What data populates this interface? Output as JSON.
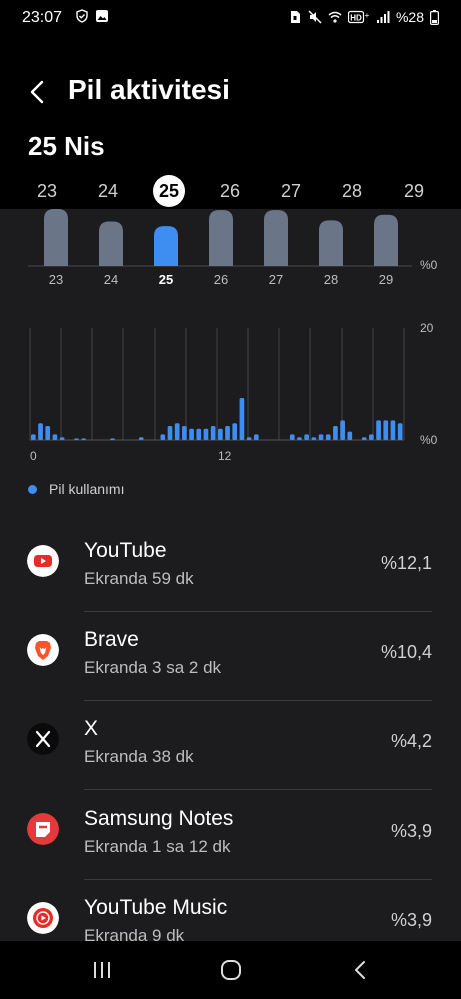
{
  "status": {
    "time": "23:07",
    "battery": "%28"
  },
  "header": {
    "title": "Pil aktivitesi"
  },
  "selected_date": "25 Nis",
  "days": [
    {
      "label": "23",
      "selected": false
    },
    {
      "label": "24",
      "selected": false
    },
    {
      "label": "25",
      "selected": true
    },
    {
      "label": "26",
      "selected": false
    },
    {
      "label": "27",
      "selected": false
    },
    {
      "label": "28",
      "selected": false
    },
    {
      "label": "29",
      "selected": false
    }
  ],
  "chart_data": [
    {
      "type": "bar",
      "categories": [
        "23",
        "24",
        "25",
        "26",
        "27",
        "28",
        "29"
      ],
      "values": [
        100,
        78,
        70,
        98,
        98,
        80,
        90
      ],
      "ylabel_min": "%0",
      "highlight": "25",
      "colors": {
        "normal": "#6b7588",
        "selected": "#3d8ef0"
      }
    },
    {
      "type": "bar",
      "x_tick_labels": [
        "0",
        "12"
      ],
      "y_tick_labels": [
        "20",
        "%0"
      ],
      "ylim": [
        0,
        20
      ],
      "values": [
        1,
        3,
        2.5,
        1,
        0.5,
        0,
        0.3,
        0.3,
        0,
        0,
        0,
        0.3,
        0,
        0,
        0,
        0.5,
        0,
        0,
        1,
        2.5,
        3,
        2.5,
        2,
        2,
        2,
        2.5,
        2,
        2.5,
        3,
        7.5,
        0.5,
        1,
        0,
        0,
        0,
        0,
        1,
        0.5,
        1,
        0.5,
        1,
        1,
        2.5,
        3.5,
        1.5,
        0,
        0.5,
        1,
        3.5,
        3.5,
        3.5,
        3
      ],
      "series": [
        {
          "name": "Pil kullanımı",
          "color": "#3d8ef0"
        }
      ]
    }
  ],
  "legend": {
    "label": "Pil kullanımı"
  },
  "apps": [
    {
      "name": "YouTube",
      "sub": "Ekranda 59 dk",
      "pct": "%12,1",
      "icon": "youtube-icon"
    },
    {
      "name": "Brave",
      "sub": "Ekranda 3 sa 2 dk",
      "pct": "%10,4",
      "icon": "brave-icon"
    },
    {
      "name": "X",
      "sub": "Ekranda 38 dk",
      "pct": "%4,2",
      "icon": "x-icon"
    },
    {
      "name": "Samsung Notes",
      "sub": "Ekranda 1 sa 12 dk",
      "pct": "%3,9",
      "icon": "samsung-notes-icon"
    },
    {
      "name": "YouTube Music",
      "sub": "Ekranda 9 dk",
      "pct": "%3,9",
      "icon": "youtube-music-icon"
    }
  ]
}
